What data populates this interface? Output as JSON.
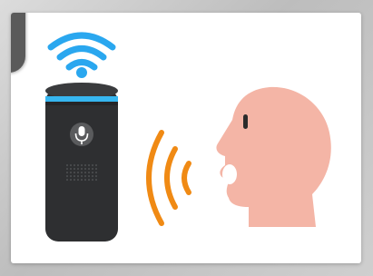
{
  "illustration": {
    "colors": {
      "wifi": "#2aa7ef",
      "speaker_body": "#2e2f31",
      "speaker_top": "#3a3b3d",
      "speaker_ring": "#36b6f0",
      "mic_button": "#5a5b5d",
      "mic_glyph": "#ffffff",
      "sound_waves": "#f08a14",
      "face": "#f4b5a6",
      "eye": "#2b2b2b",
      "mouth": "#ffffff"
    },
    "icons": {
      "wifi": "wifi-icon",
      "microphone": "microphone-icon",
      "sound_waves": "sound-waves-icon",
      "speaker": "smart-speaker",
      "head": "human-head-profile"
    }
  }
}
